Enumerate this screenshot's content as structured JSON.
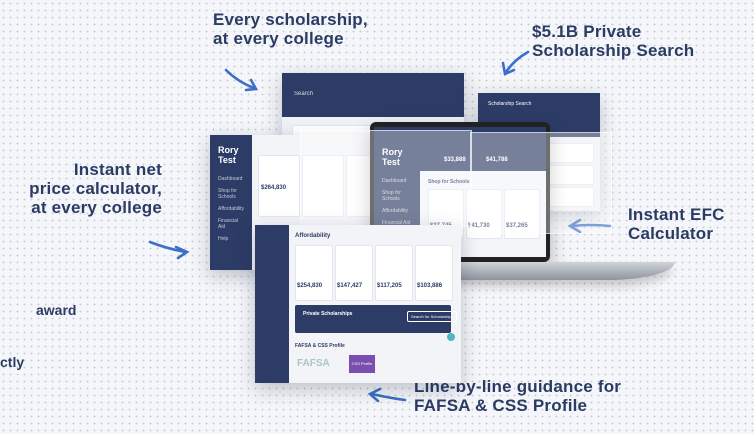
{
  "callouts": {
    "top_center": [
      "Every scholarship,",
      "at every college"
    ],
    "top_right": [
      "$5.1B Private",
      "Scholarship Search"
    ],
    "left": [
      "Instant net",
      "price calculator,",
      "at every college"
    ],
    "right": [
      "Instant EFC",
      "Calculator"
    ],
    "bottom": [
      "Line-by-line guidance for",
      "FAFSA & CSS Profile"
    ]
  },
  "clipped_left": [
    "award",
    "ctly"
  ],
  "screens": {
    "laptop": {
      "student_name": "Rory Test",
      "nav": [
        "Dashboard",
        "Shop for Schools",
        "Affordability",
        "Financial Aid"
      ],
      "section": "Shop for Schools",
      "stats": [
        "$33,888",
        "$41,788"
      ],
      "values": [
        "$37,745",
        "$41,730",
        "$37,265"
      ]
    },
    "left_screen": {
      "student_name": "Rory Test",
      "nav": [
        "Dashboard",
        "Shop for Schools",
        "Affordability",
        "Financial Aid",
        "Help"
      ],
      "values": [
        "$264,830"
      ]
    },
    "front_screen": {
      "title": "Affordability",
      "values": [
        "$254,830",
        "$147,427",
        "$117,205",
        "$103,886"
      ],
      "banner": "Private Scholarships",
      "banner_button": "Search for Scholarships",
      "footer_title": "FAFSA & CSS Profile",
      "fafsa_logo": "FAFSA",
      "css_label": "CSS Profile"
    },
    "top_screen": {
      "header": "Search"
    },
    "right_screen": {
      "title": "Scholarship Search"
    }
  },
  "colors": {
    "navy": "#2d3c66",
    "accent_blue": "#3d6fc8",
    "text": "#2b3b63",
    "teal": "#4fb7c4",
    "purple": "#7b4fb0"
  }
}
